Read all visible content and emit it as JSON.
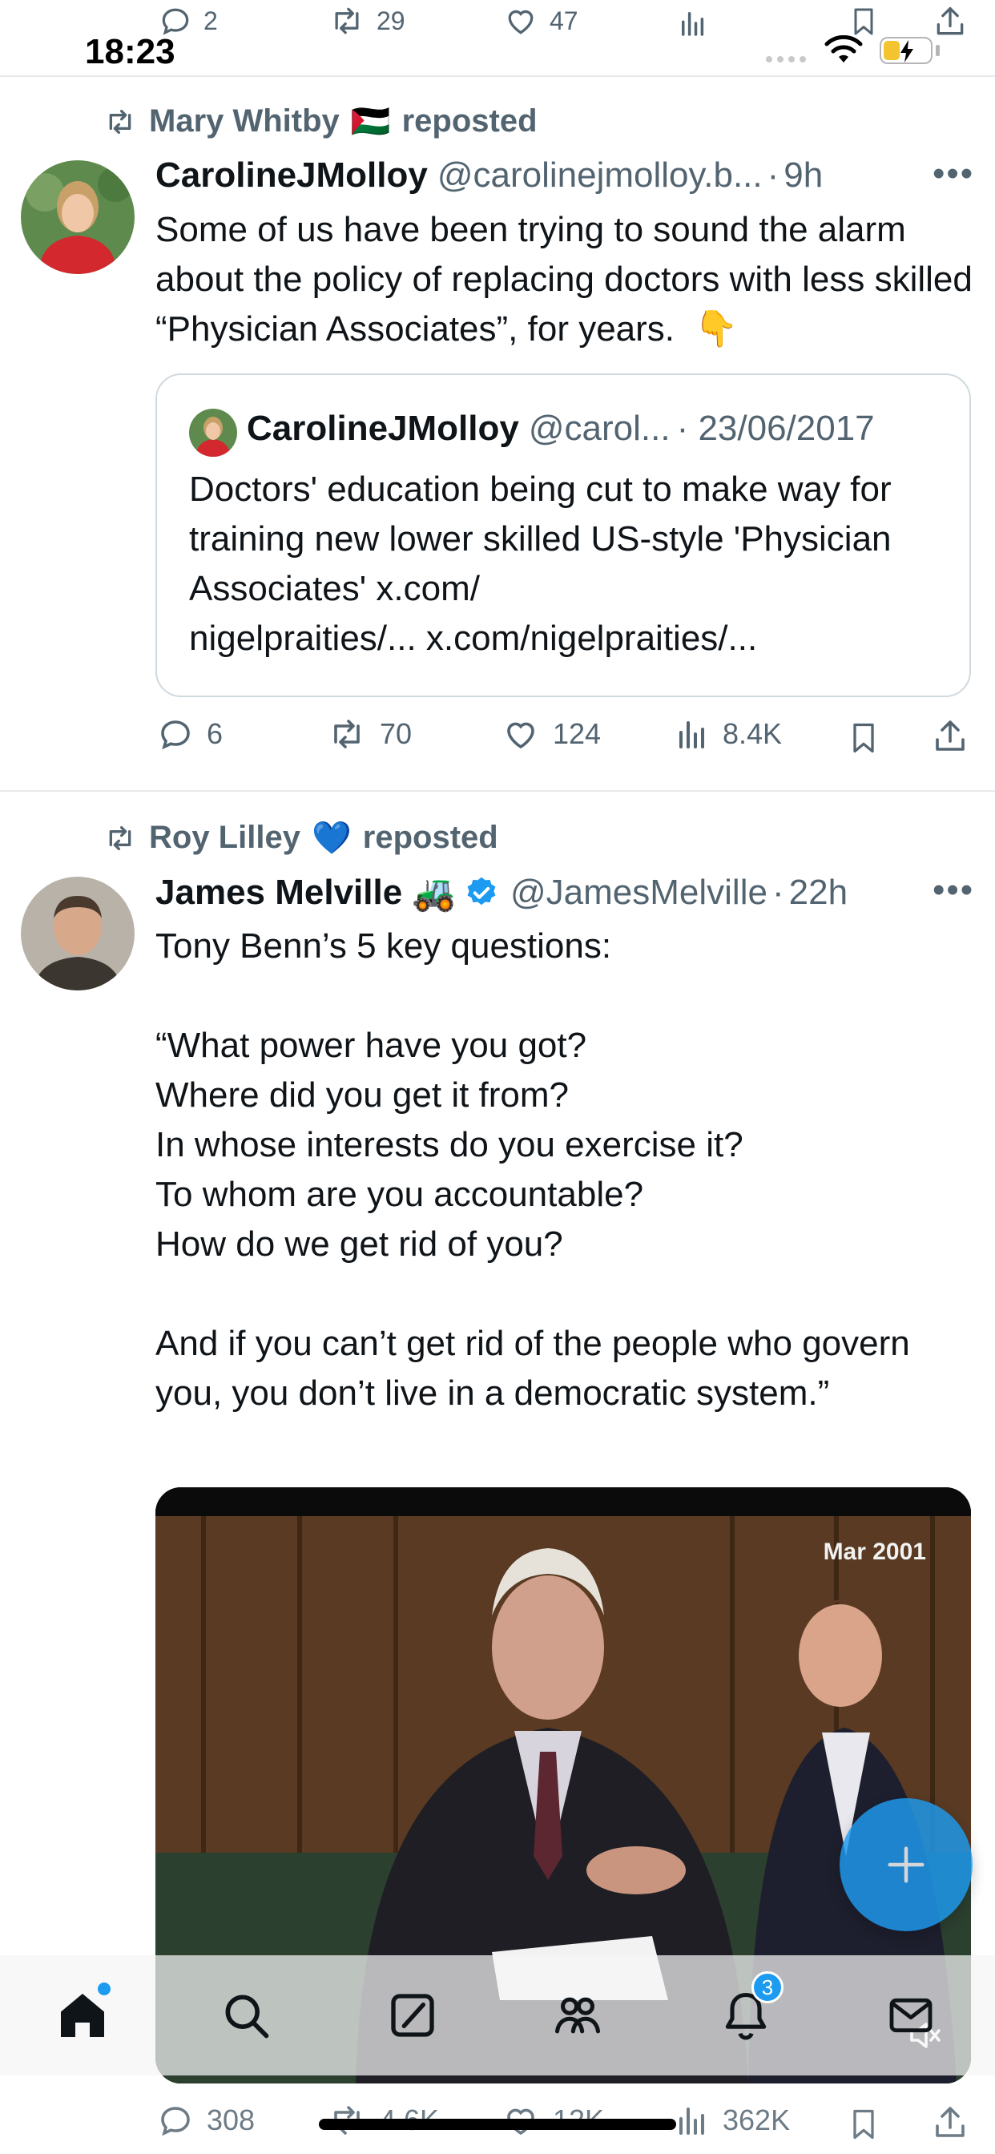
{
  "status_bar": {
    "time": "18:23"
  },
  "previous_tweet_actions": {
    "replies": "2",
    "reposts": "29",
    "likes": "47"
  },
  "tweets": [
    {
      "reposted_by": "Mary Whitby",
      "reposted_by_flag": "🇵🇸",
      "reposted_label": "reposted",
      "author_name": "CarolineJMolloy",
      "author_handle": "@carolinejmolloy.b...",
      "separator": "·",
      "time": "9h",
      "text": "Some of us have been trying to sound the alarm about the policy of replacing doctors with less skilled “Physician Associates”, for years.  👇",
      "quote": {
        "author_name": "CarolineJMolloy",
        "author_handle": "@carol...",
        "date": "· 23/06/2017",
        "text": "Doctors' education being cut to make way for training new lower skilled US-style 'Physician Associates' x.com/\nnigelpraities/... x.com/nigelpraities/..."
      },
      "actions": {
        "replies": "6",
        "reposts": "70",
        "likes": "124",
        "views": "8.4K"
      }
    },
    {
      "reposted_by": "Roy Lilley",
      "reposted_by_emoji": "💙",
      "reposted_label": "reposted",
      "author_name": "James Melville",
      "author_emoji": "🚜",
      "author_handle": "@JamesMelville",
      "separator": "·",
      "time": "22h",
      "text": "Tony Benn’s 5 key questions:\n\n“What power have you got?\nWhere did you get it from?\nIn whose interests do you exercise it?\nTo whom are you accountable?\nHow do we get rid of you?\n\nAnd if you can’t get rid of the people who govern you, you don’t live in a democratic system.”",
      "video": {
        "overlay_date": "Mar 2001"
      },
      "actions": {
        "replies": "308",
        "reposts": "4.6K",
        "likes": "12K",
        "views": "362K"
      }
    }
  ],
  "tab_bar": {
    "items": [
      "home-icon",
      "search-icon",
      "grok-icon",
      "communities-icon",
      "notifications-icon",
      "messages-icon"
    ],
    "notifications_badge": "3"
  },
  "colors": {
    "accent": "#1d9bf0",
    "text": "#0f1419",
    "secondary": "#536471",
    "border": "#cfd9de"
  }
}
